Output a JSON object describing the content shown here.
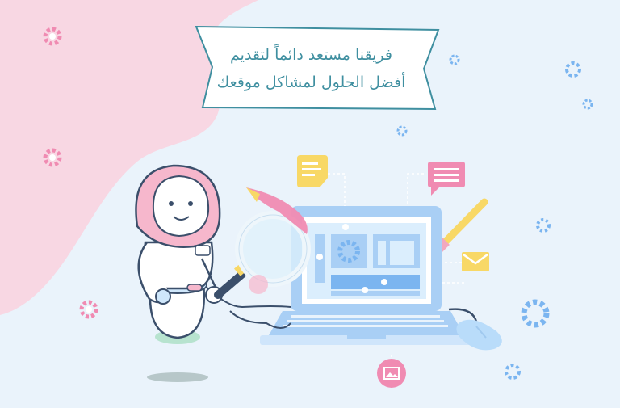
{
  "banner": {
    "line1": "فريقنا مستعد دائماً لتقديم",
    "line2": "أفضل الحلول لمشاكل موقعك"
  },
  "colors": {
    "background": "#eaf3fb",
    "pink_blob": "#f8d7e3",
    "banner_fill": "#ffffff",
    "banner_stroke": "#3f8fa0",
    "gear_pink": "#f08bb2",
    "gear_blue": "#7bb5f0",
    "laptop_blue": "#a9cff5",
    "robot_pink": "#f6b7cc"
  },
  "icons": [
    "gear-icon",
    "note-icon",
    "chat-icon",
    "mail-icon",
    "image-icon",
    "magnifier-icon",
    "brush-icon",
    "mouse-icon"
  ]
}
